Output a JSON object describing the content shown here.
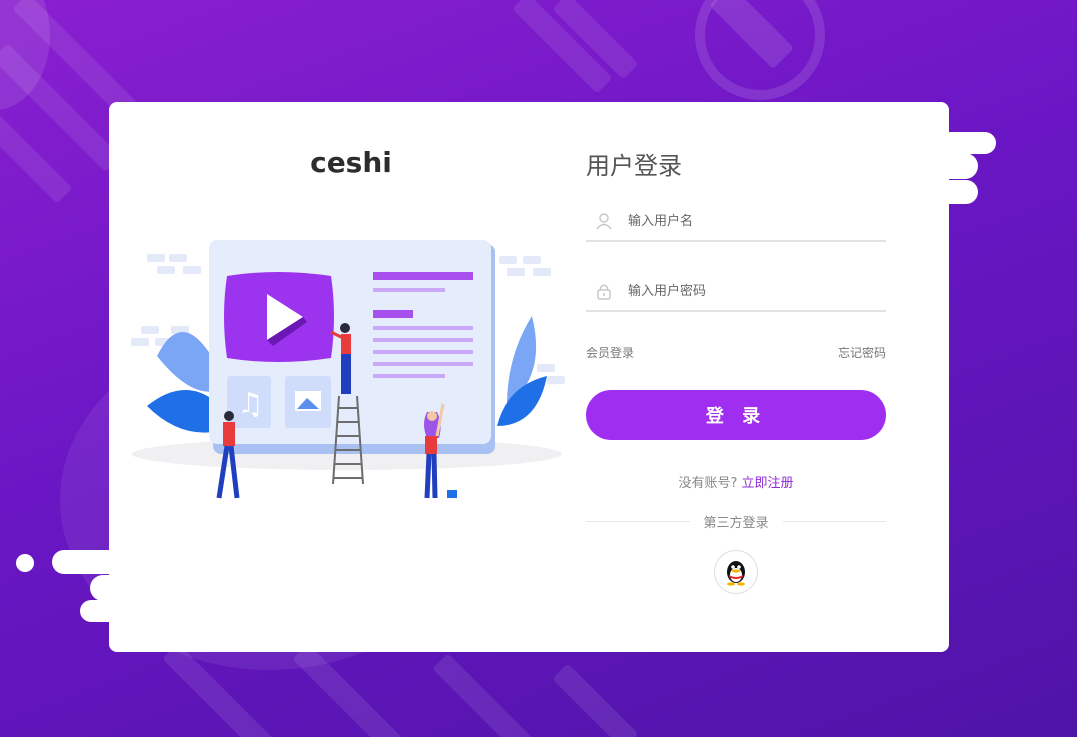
{
  "brand": {
    "name": "ceshi"
  },
  "login": {
    "title": "用户登录",
    "username_placeholder": "输入用户名",
    "password_placeholder": "输入用户密码",
    "member_login": "会员登录",
    "forgot_password": "忘记密码",
    "submit_label": "登 录",
    "no_account_text": "没有账号?",
    "register_link": "立即注册",
    "third_party_label": "第三方登录"
  },
  "icons": {
    "username": "user-icon",
    "password": "lock-icon",
    "qq": "qq-penguin-icon",
    "illustration": "video-content-team-illustration"
  },
  "colors": {
    "accent": "#a02ef0",
    "link": "#8f2bd6",
    "background_start": "#8a1fd0",
    "background_end": "#4f14a8"
  }
}
